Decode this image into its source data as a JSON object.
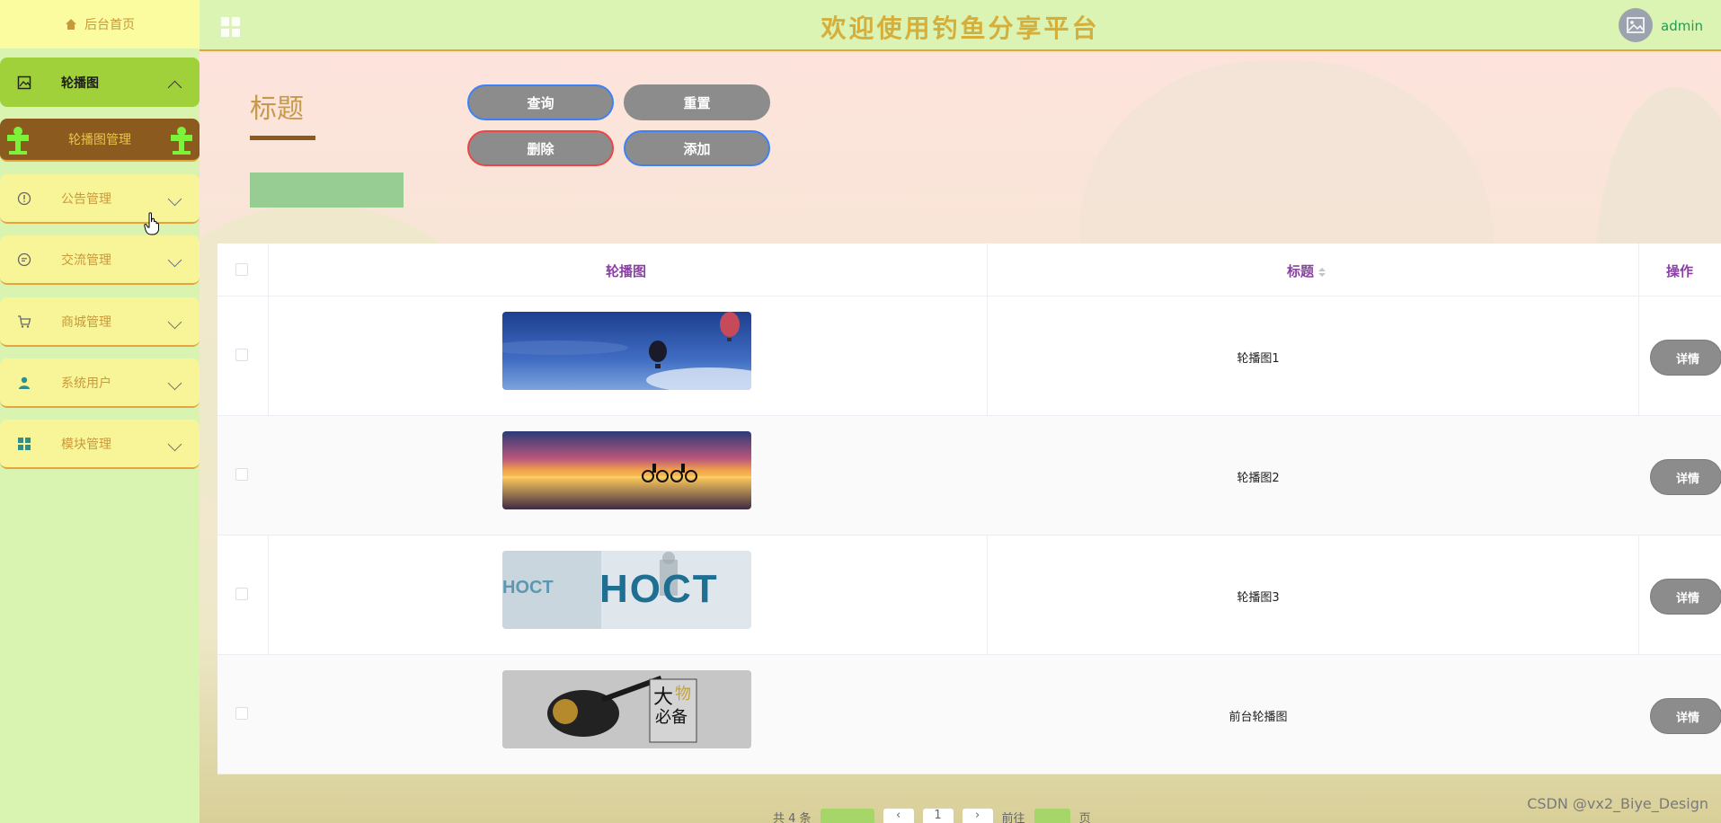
{
  "header": {
    "title": "欢迎使用钓鱼分享平台",
    "user": "admin"
  },
  "sidebar": {
    "home": "后台首页",
    "items": [
      {
        "label": "轮播图",
        "icon": "image-icon"
      },
      {
        "label": "公告管理",
        "icon": "info-circle-icon"
      },
      {
        "label": "交流管理",
        "icon": "chat-icon"
      },
      {
        "label": "商城管理",
        "icon": "cart-icon"
      },
      {
        "label": "系统用户",
        "icon": "user-icon"
      },
      {
        "label": "模块管理",
        "icon": "grid-icon"
      }
    ],
    "sub_item": "轮播图管理"
  },
  "search": {
    "label": "标题",
    "placeholder": ""
  },
  "buttons": {
    "query": "查询",
    "reset": "重置",
    "delete": "删除",
    "add": "添加"
  },
  "table": {
    "columns": [
      "轮播图",
      "标题",
      "操作"
    ],
    "rows": [
      {
        "title": "轮播图1",
        "action": "详情"
      },
      {
        "title": "轮播图2",
        "action": "详情"
      },
      {
        "title": "轮播图3",
        "action": "详情"
      },
      {
        "title": "前台轮播图",
        "action": "详情"
      }
    ]
  },
  "pager": {
    "total_prefix": "共 4 条",
    "current_page": "1",
    "goto_prefix": "前往",
    "goto_suffix": "页"
  },
  "thumb_text": {
    "row3": "HOCT",
    "row4_big": "大",
    "row4_line1": "物",
    "row4_line2": "必备"
  },
  "watermark": "CSDN @vx2_Biye_Design",
  "colors": {
    "accent": "#a0d13a",
    "title": "#d6ae3a",
    "button": "#8c8c8c",
    "header_text": "#8b3fa7"
  }
}
